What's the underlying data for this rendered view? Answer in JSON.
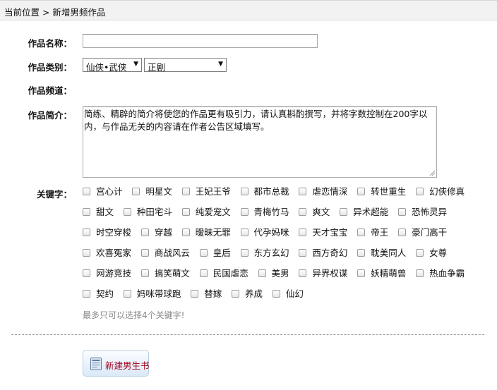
{
  "breadcrumb": {
    "text": "当前位置 > 新增男频作品"
  },
  "form": {
    "name_label": "作品名称：",
    "name_value": "",
    "category_label": "作品类别：",
    "category_value": "仙侠•武侠",
    "type_value": "正剧",
    "channel_label": "作品频道：",
    "intro_label": "作品简介：",
    "intro_text": "简练、精辟的简介将使您的作品更有吸引力，请认真斟酌撰写，并将字数控制在200字以内，与作品无关的内容请在作者公告区域填写。",
    "keywords_label": "关键字：",
    "keywords": [
      [
        "宫心计",
        "明星文",
        "王妃王爷",
        "都市总裁",
        "虐恋情深",
        "转世重生",
        "幻侠修真"
      ],
      [
        "甜文",
        "种田宅斗",
        "纯爱宠文",
        "青梅竹马",
        "爽文",
        "异术超能",
        "恐怖灵异"
      ],
      [
        "时空穿梭",
        "穿越",
        "暧昧无罪",
        "代孕妈咪",
        "天才宝宝",
        "帝王",
        "豪门高干"
      ],
      [
        "欢喜冤家",
        "商战风云",
        "皇后",
        "东方玄幻",
        "西方奇幻",
        "耽美同人",
        "女尊"
      ],
      [
        "网游竞技",
        "搞笑萌文",
        "民国虐恋",
        "美男",
        "异界权谋",
        "妖精萌兽",
        "热血争霸"
      ],
      [
        "契约",
        "妈咪带球跑",
        "替嫁",
        "养成",
        "仙幻"
      ]
    ],
    "keywords_hint": "最多只可以选择4个关键字!",
    "create_button": "新建男生书"
  }
}
